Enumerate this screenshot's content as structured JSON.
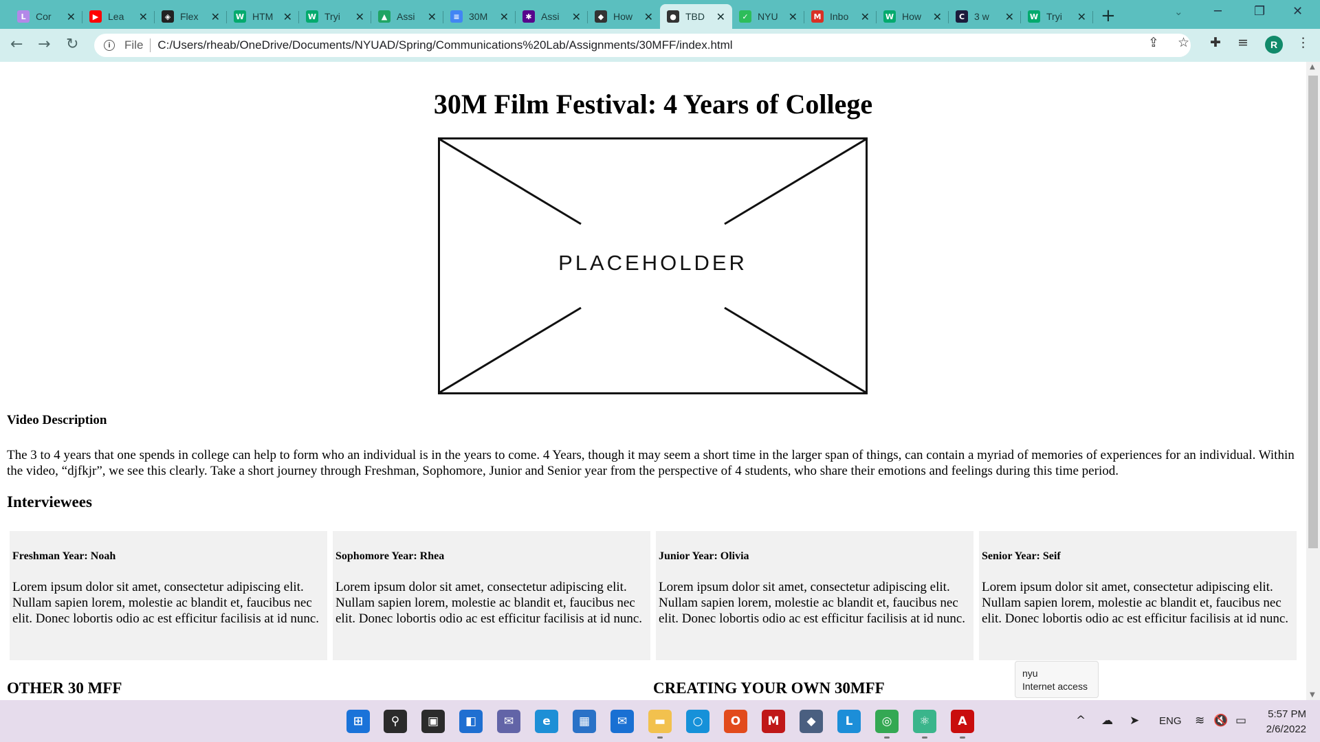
{
  "browser": {
    "tabs": [
      {
        "title": "Cor",
        "favicon": "canva-icon",
        "color": "#b388e8",
        "glyph": "L"
      },
      {
        "title": "Lea",
        "favicon": "youtube-icon",
        "color": "#ff0000",
        "glyph": "▶"
      },
      {
        "title": "Flex",
        "favicon": "codepen-icon",
        "color": "#222222",
        "glyph": "◈"
      },
      {
        "title": "HTM",
        "favicon": "w3schools-icon",
        "color": "#04aa6d",
        "glyph": "W"
      },
      {
        "title": "Tryi",
        "favicon": "w3schools-icon",
        "color": "#04aa6d",
        "glyph": "W"
      },
      {
        "title": "Assi",
        "favicon": "google-drive-icon",
        "color": "#1fa463",
        "glyph": "▲"
      },
      {
        "title": "30M",
        "favicon": "google-docs-icon",
        "color": "#4285f4",
        "glyph": "≡"
      },
      {
        "title": "Assi",
        "favicon": "nyu-icon",
        "color": "#57068c",
        "glyph": "✱"
      },
      {
        "title": "How",
        "favicon": "code-icon",
        "color": "#333333",
        "glyph": "◆"
      },
      {
        "title": "TBD",
        "favicon": "globe-icon",
        "color": "#333333",
        "glyph": "●"
      },
      {
        "title": "NYU",
        "favicon": "checkmark-icon",
        "color": "#2dbd5a",
        "glyph": "✓"
      },
      {
        "title": "Inbo",
        "favicon": "gmail-icon",
        "color": "#d93025",
        "glyph": "M"
      },
      {
        "title": "How",
        "favicon": "w3schools-icon",
        "color": "#04aa6d",
        "glyph": "W"
      },
      {
        "title": "3 w",
        "favicon": "c-icon",
        "color": "#1c1c3c",
        "glyph": "C"
      },
      {
        "title": "Tryi",
        "favicon": "w3schools-icon",
        "color": "#04aa6d",
        "glyph": "W"
      }
    ],
    "active_tab_index": 9,
    "address": {
      "scheme": "File",
      "url": "C:/Users/rheab/OneDrive/Documents/NYUAD/Spring/Communications%20Lab/Assignments/30MFF/index.html"
    },
    "profile_initial": "R"
  },
  "page": {
    "title": "30M Film Festival: 4 Years of College",
    "placeholder_text": "PLACEHOLDER",
    "video_description_heading": "Video Description",
    "video_description": "The 3 to 4 years that one spends in college can help to form who an individual is in the years to come. 4 Years, though it may seem a short time in the larger span of things, can contain a myriad of memories of experiences for an individual. Within the video, “djfkjr”, we see this clearly. Take a short journey through Freshman, Sophomore, Junior and Senior year from the perspective of 4 students, who share their emotions and feelings during this time period.",
    "interviewees_heading": "Interviewees",
    "interviewees": [
      {
        "heading": "Freshman Year: Noah",
        "text": "Lorem ipsum dolor sit amet, consectetur adipiscing elit. Nullam sapien lorem, molestie ac blandit et, faucibus nec elit. Donec lobortis odio ac est efficitur facilisis at id nunc."
      },
      {
        "heading": "Sophomore Year: Rhea",
        "text": "Lorem ipsum dolor sit amet, consectetur adipiscing elit. Nullam sapien lorem, molestie ac blandit et, faucibus nec elit. Donec lobortis odio ac est efficitur facilisis at id nunc."
      },
      {
        "heading": "Junior Year: Olivia",
        "text": "Lorem ipsum dolor sit amet, consectetur adipiscing elit. Nullam sapien lorem, molestie ac blandit et, faucibus nec elit. Donec lobortis odio ac est efficitur facilisis at id nunc."
      },
      {
        "heading": "Senior Year: Seif",
        "text": "Lorem ipsum dolor sit amet, consectetur adipiscing elit. Nullam sapien lorem, molestie ac blandit et, faucibus nec elit. Donec lobortis odio ac est efficitur facilisis at id nunc."
      }
    ],
    "other_heading": "OTHER 30 MFF",
    "creating_heading": "CREATING YOUR OWN 30MFF"
  },
  "tooltip": {
    "network_name": "nyu",
    "status": "Internet access"
  },
  "taskbar": {
    "apps": [
      {
        "name": "windows-start-icon",
        "color": "#1a73d9",
        "glyph": "⊞"
      },
      {
        "name": "search-icon",
        "color": "#2b2b2b",
        "glyph": "⚲"
      },
      {
        "name": "task-view-icon",
        "color": "#2b2b2b",
        "glyph": "▣"
      },
      {
        "name": "widgets-icon",
        "color": "#1f6fd1",
        "glyph": "◧"
      },
      {
        "name": "teams-chat-icon",
        "color": "#6264a7",
        "glyph": "✉"
      },
      {
        "name": "edge-icon",
        "color": "#1d8fd6",
        "glyph": "e"
      },
      {
        "name": "store-icon",
        "color": "#2a72c7",
        "glyph": "▦"
      },
      {
        "name": "mail-icon",
        "color": "#1970d3",
        "glyph": "✉"
      },
      {
        "name": "file-explorer-icon",
        "color": "#f2c14e",
        "glyph": "▬"
      },
      {
        "name": "cortana-icon",
        "color": "#1691d9",
        "glyph": "○"
      },
      {
        "name": "office-icon",
        "color": "#e24b1c",
        "glyph": "O"
      },
      {
        "name": "mcafee-icon",
        "color": "#c01818",
        "glyph": "M"
      },
      {
        "name": "virtualbox-icon",
        "color": "#4a5f80",
        "glyph": "◆"
      },
      {
        "name": "lockdown-browser-icon",
        "color": "#1c8ed8",
        "glyph": "L"
      },
      {
        "name": "chrome-icon",
        "color": "#34a853",
        "glyph": "◎"
      },
      {
        "name": "atom-icon",
        "color": "#3ab58b",
        "glyph": "⚛"
      },
      {
        "name": "acrobat-icon",
        "color": "#c90d0d",
        "glyph": "A"
      }
    ],
    "tray": {
      "language": "ENG",
      "time": "5:57 PM",
      "date": "2/6/2022"
    }
  }
}
